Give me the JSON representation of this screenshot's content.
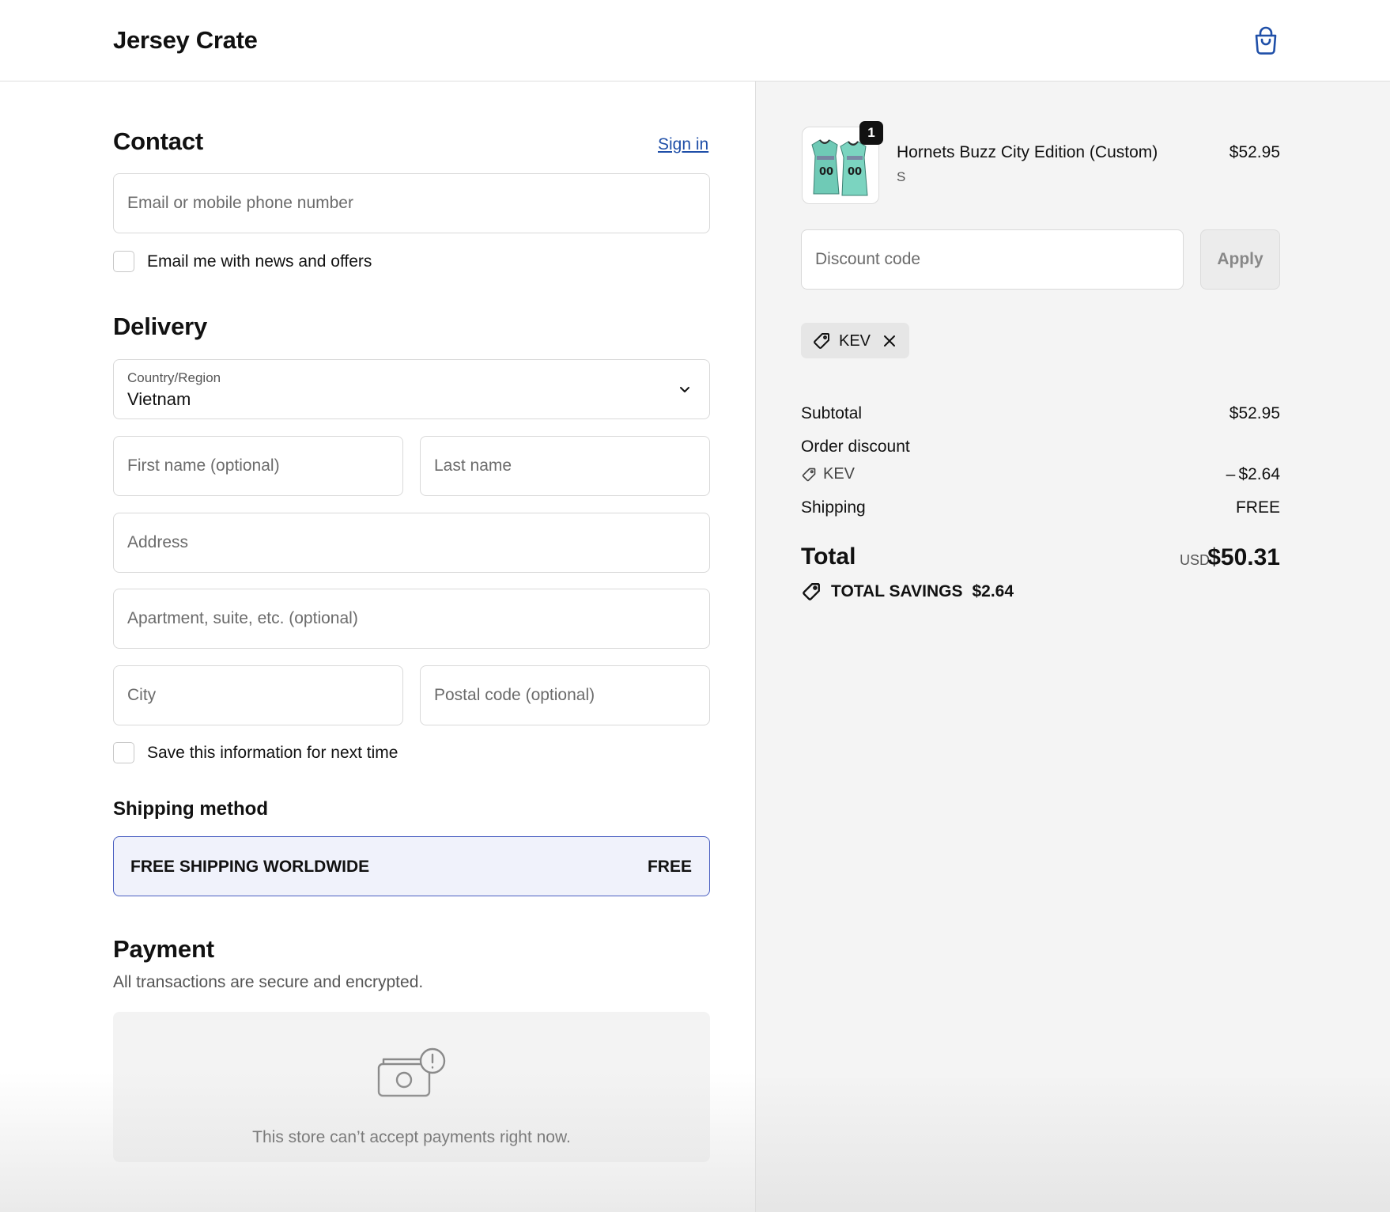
{
  "header": {
    "brand": "Jersey Crate",
    "cart_icon": "shopping-bag-icon"
  },
  "contact": {
    "title": "Contact",
    "sign_in": "Sign in",
    "email_placeholder": "Email or mobile phone number",
    "newsletter_label": "Email me with news and offers"
  },
  "delivery": {
    "title": "Delivery",
    "country_label": "Country/Region",
    "country_value": "Vietnam",
    "first_name_placeholder": "First name (optional)",
    "last_name_placeholder": "Last name",
    "address_placeholder": "Address",
    "apartment_placeholder": "Apartment, suite, etc. (optional)",
    "city_placeholder": "City",
    "postal_placeholder": "Postal code (optional)",
    "save_info_label": "Save this information for next time"
  },
  "shipping_method": {
    "title": "Shipping method",
    "option_name": "FREE SHIPPING WORLDWIDE",
    "option_price": "FREE"
  },
  "payment": {
    "title": "Payment",
    "subtitle": "All transactions are secure and encrypted.",
    "unavailable_message": "This store can’t accept payments right now."
  },
  "order": {
    "item": {
      "name": "Hornets Buzz City Edition (Custom)",
      "variant": "S",
      "price": "$52.95",
      "quantity": "1"
    },
    "discount_placeholder": "Discount code",
    "apply_label": "Apply",
    "applied_code": "KEV",
    "subtotal_label": "Subtotal",
    "subtotal_value": "$52.95",
    "order_discount_label": "Order discount",
    "discount_code": "KEV",
    "discount_value": "– $2.64",
    "shipping_label": "Shipping",
    "shipping_value": "FREE",
    "total_label": "Total",
    "currency": "USD",
    "total_value": "$50.31",
    "savings_label": "TOTAL SAVINGS",
    "savings_value": "$2.64"
  },
  "colors": {
    "accent": "#1f4fa8",
    "selected_border": "#4a5fc1",
    "selected_bg": "#f0f2fb",
    "panel_bg": "#f4f4f4",
    "jersey": "#6fcab6"
  }
}
